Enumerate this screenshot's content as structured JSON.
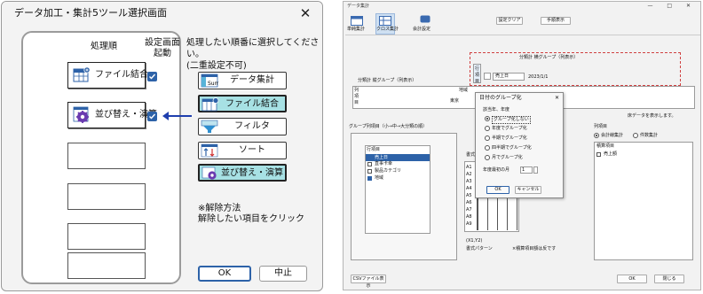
{
  "left_dialog": {
    "title": "データ加工・集計5ツール選択画面",
    "close_glyph": "✕",
    "headers": {
      "order": "処理順",
      "startup_line1": "設定画面",
      "startup_line2": "起動"
    },
    "slots": [
      {
        "label": "ファイル結合",
        "icon": "file-merge-icon",
        "checked": true
      },
      {
        "label": "並び替え・演算",
        "icon": "gear-calc-icon",
        "checked": true
      },
      {
        "label": ""
      },
      {
        "label": ""
      },
      {
        "label": ""
      },
      {
        "label": ""
      }
    ],
    "arrow": "←",
    "instruction_line1": "処理したい順番に選択してください。",
    "instruction_line2": "(二重設定不可)",
    "operations": [
      {
        "label": "データ集計",
        "icon": "sum-table-icon",
        "selected": false
      },
      {
        "label": "ファイル結合",
        "icon": "file-merge-icon",
        "selected": true
      },
      {
        "label": "フィルタ",
        "icon": "funnel-filter-icon",
        "selected": false
      },
      {
        "label": "ソート",
        "icon": "sort-arrows-icon",
        "selected": false
      },
      {
        "label": "並び替え・演算",
        "icon": "gear-calc-icon",
        "selected": true
      }
    ],
    "note_line1": "※解除方法",
    "note_line2": "解除したい項目をクリック",
    "ok_label": "OK",
    "cancel_label": "中止",
    "accent": "#2d62a8",
    "selected_fill": "#a7e1e4"
  },
  "right_window": {
    "title": "データ集計",
    "window_controls": "— □ ✕",
    "toolbar": [
      {
        "label": "単純集計"
      },
      {
        "label": "クロス集計"
      },
      {
        "label": "会計設定"
      }
    ],
    "settings_clear": "設定クリア",
    "procedure_view": "手順表示",
    "col_group_title": "分類計  横グループ（列表示）",
    "col_group_row_label": "行項目",
    "sales_date": "売上日",
    "date_value": "2023/1/1",
    "row_group_title": "分類計  縦グループ（列表示）",
    "row_label": "列項目",
    "region_header": "地域",
    "region_value": "東京",
    "hint_text": "床データを表示します。",
    "group_list_title": "グループ列項目（小→中→大分類の順）",
    "list_header": "行項目",
    "list_items": [
      {
        "label": "売上日",
        "checked": true,
        "highlight": true
      },
      {
        "label": "直事卡幸",
        "checked": false
      },
      {
        "label": "製品カテゴリ",
        "checked": false
      },
      {
        "label": "地域",
        "checked": true
      }
    ],
    "format_label": "書式パタ",
    "cells": [
      "A1",
      "A2",
      "A3",
      "A4",
      "A5",
      "A6",
      "A7",
      "A8",
      "A9"
    ],
    "xy_label": "(X1,Y2)",
    "pattern_label": "書式パターン",
    "pattern_note": "×積算項目額は反です",
    "right_panel_title": "列項目",
    "calc_mode_a": "会計線集計",
    "calc_mode_b": "件数集計",
    "agg_header": "積算項目",
    "agg_items": [
      {
        "label": "売上額",
        "checked": false
      }
    ],
    "csv_button": "CSVファイル表示",
    "ok_label": "OK",
    "close_label": "閉じる",
    "sub_dialog": {
      "title": "日付のグループ化",
      "close_glyph": "✕",
      "section": "該当年、年度",
      "options": [
        {
          "label": "グループ化しない",
          "on": true
        },
        {
          "label": "年度でグループ化",
          "on": false
        },
        {
          "label": "半期でグループ化",
          "on": false
        },
        {
          "label": "四半期でグループ化",
          "on": false
        },
        {
          "label": "月でグループ化",
          "on": false
        }
      ],
      "start_month_label": "年度最初の月",
      "start_month_value": "1",
      "ok_label": "OK",
      "cancel_label": "キャンセル"
    }
  }
}
